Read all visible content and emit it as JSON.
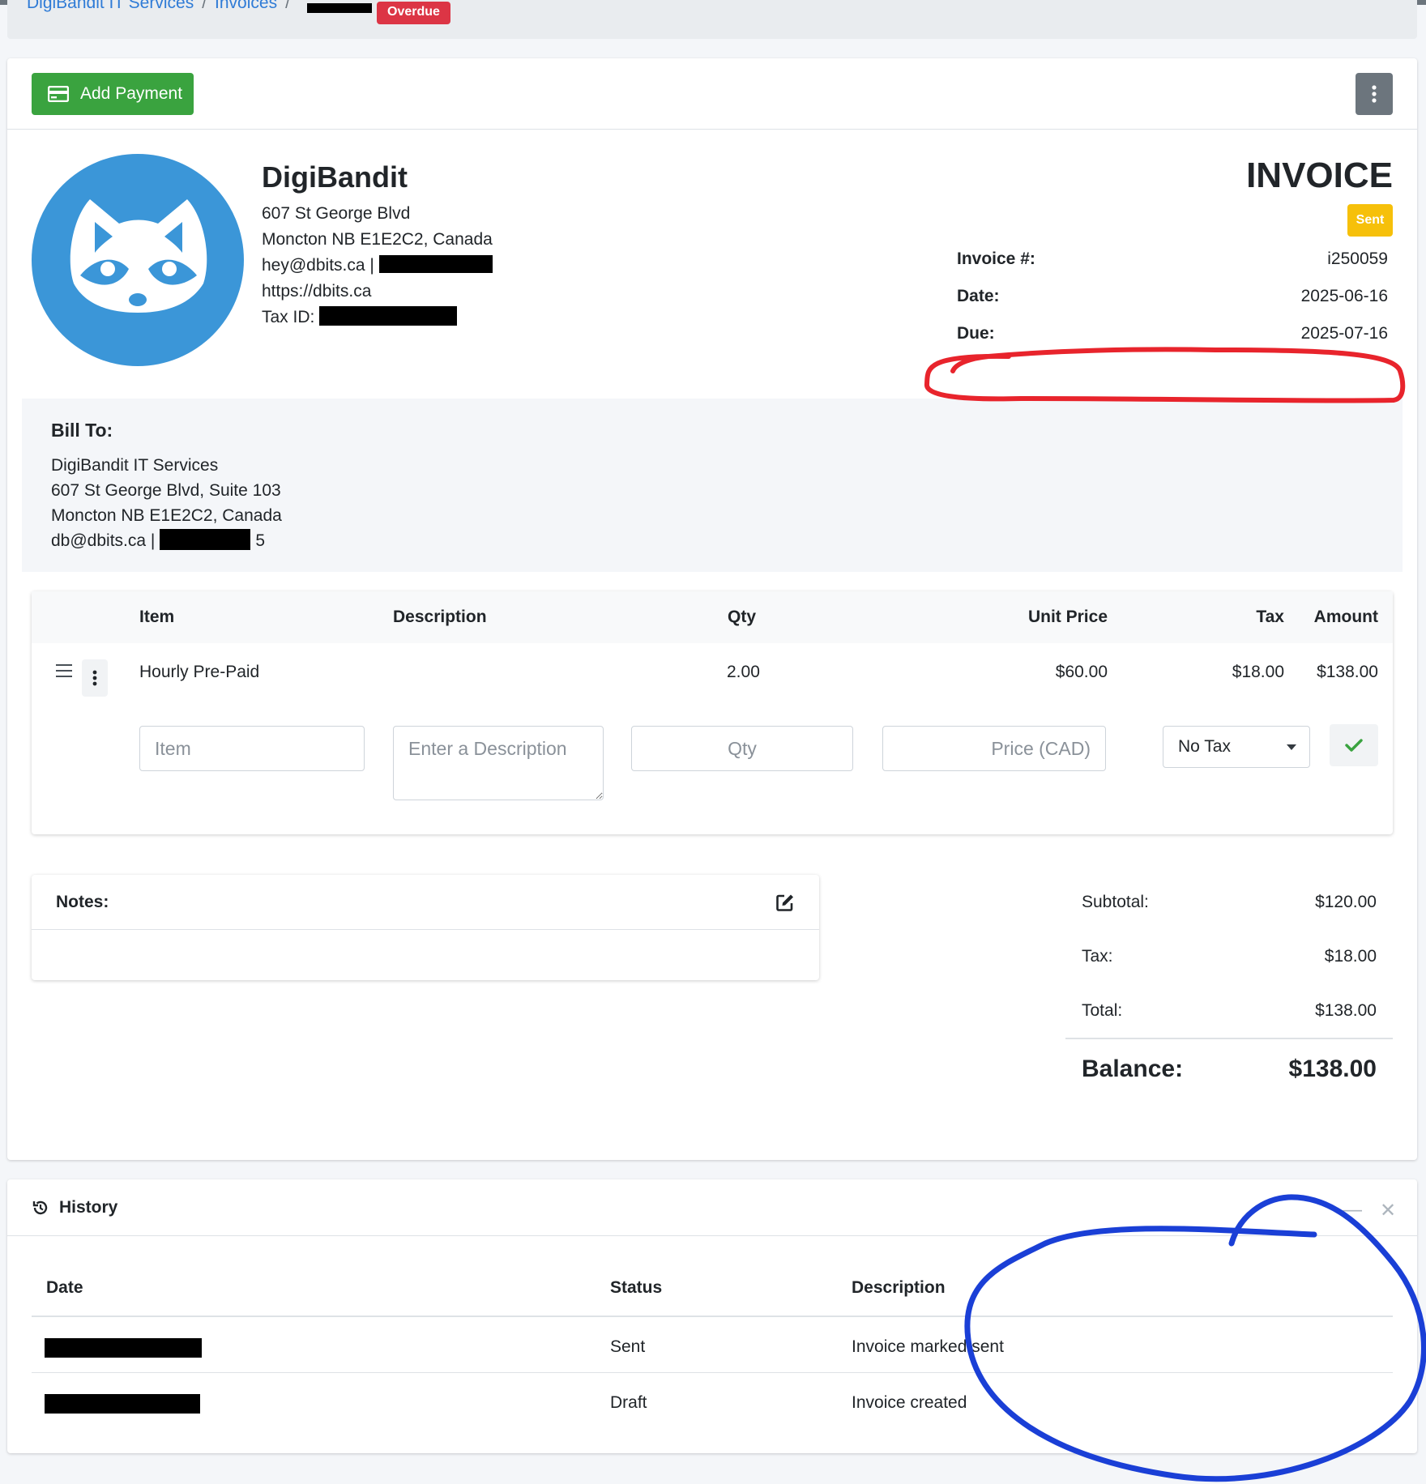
{
  "breadcrumb": {
    "client": "DigiBandit IT Services",
    "section": "Invoices",
    "status_badge": "Overdue"
  },
  "toolbar": {
    "add_payment_label": "Add Payment"
  },
  "company": {
    "name": "DigiBandit",
    "address1": "607 St George Blvd",
    "address2": "Moncton NB E1E2C2, Canada",
    "email": "hey@dbits.ca |",
    "website": "https://dbits.ca",
    "tax_id_label": "Tax ID:"
  },
  "invoice": {
    "title": "INVOICE",
    "status": "Sent",
    "number_label": "Invoice #:",
    "number": "i250059",
    "date_label": "Date:",
    "date": "2025-06-16",
    "due_label": "Due:",
    "due": "2025-07-16"
  },
  "bill_to": {
    "label": "Bill To:",
    "name": "DigiBandit IT Services",
    "address1": "607 St George Blvd, Suite 103",
    "address2": "Moncton NB E1E2C2, Canada",
    "email": "db@dbits.ca |",
    "phone_tail": "5"
  },
  "items": {
    "headers": {
      "item": "Item",
      "description": "Description",
      "qty": "Qty",
      "unit_price": "Unit Price",
      "tax": "Tax",
      "amount": "Amount"
    },
    "rows": [
      {
        "item": "Hourly Pre-Paid",
        "description": "",
        "qty": "2.00",
        "unit_price": "$60.00",
        "tax": "$18.00",
        "amount": "$138.00"
      }
    ],
    "new_row": {
      "item_placeholder": "Item",
      "description_placeholder": "Enter a Description",
      "qty_placeholder": "Qty",
      "price_placeholder": "Price (CAD)",
      "tax_selected": "No Tax"
    }
  },
  "notes": {
    "label": "Notes:"
  },
  "totals": {
    "subtotal_label": "Subtotal:",
    "subtotal": "$120.00",
    "tax_label": "Tax:",
    "tax": "$18.00",
    "total_label": "Total:",
    "total": "$138.00",
    "balance_label": "Balance:",
    "balance": "$138.00"
  },
  "history": {
    "title": "History",
    "headers": {
      "date": "Date",
      "status": "Status",
      "description": "Description"
    },
    "rows": [
      {
        "status": "Sent",
        "description": "Invoice marked sent"
      },
      {
        "status": "Draft",
        "description": "Invoice created"
      }
    ]
  },
  "colors": {
    "success": "#3aa33f",
    "danger": "#dc3545",
    "warning": "#f6c00a",
    "link": "#2f7bd6",
    "logo_blue": "#3b96d8"
  },
  "icons": [
    "credit-card-icon",
    "kebab-icon",
    "raccoon-logo",
    "drag-handle-icon",
    "check-icon",
    "edit-icon",
    "history-icon",
    "minus-icon",
    "close-icon"
  ]
}
